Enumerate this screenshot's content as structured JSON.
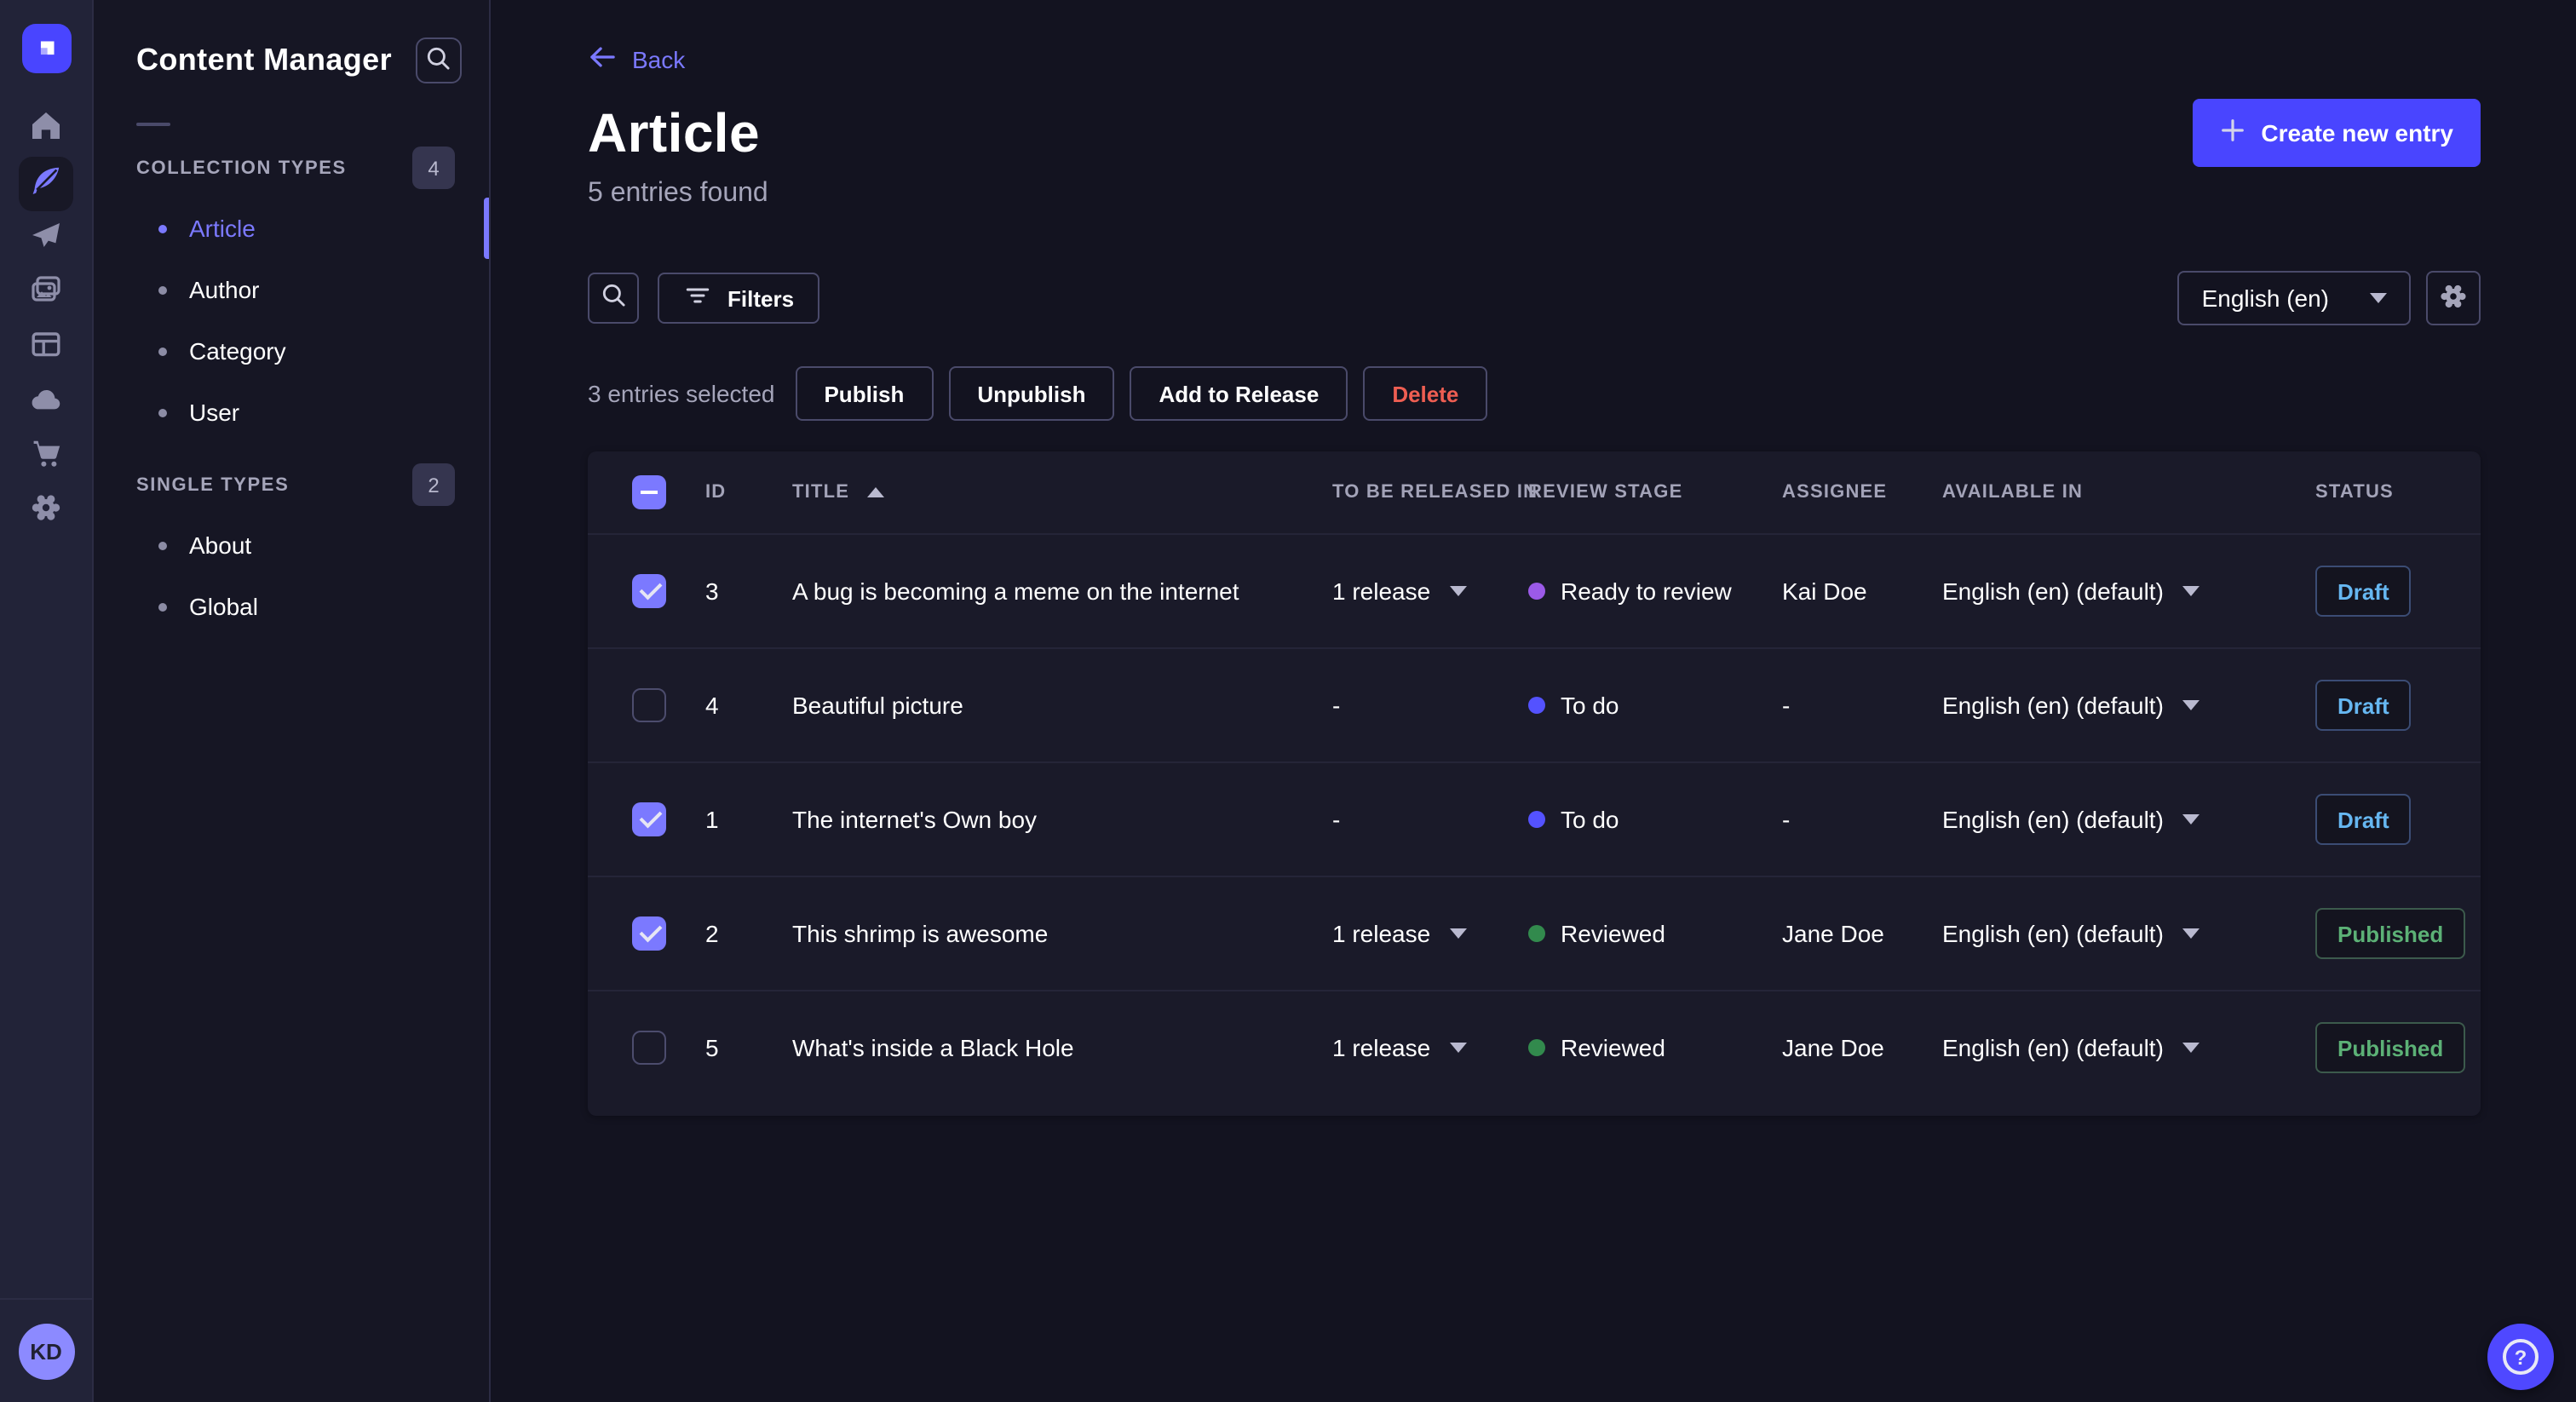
{
  "colors": {
    "primary": "#4945ff",
    "accent": "#7b79ff",
    "danger": "#ee5e52",
    "status_draft": "#66b7f1",
    "status_published": "#5cb176",
    "stage_ready_to_review": "#9b5ae8",
    "stage_to_do": "#5452ff",
    "stage_reviewed": "#328a4d"
  },
  "rail": {
    "items": [
      {
        "name": "home",
        "active": false
      },
      {
        "name": "content-manager",
        "active": true
      },
      {
        "name": "releases",
        "active": false
      },
      {
        "name": "media-library",
        "active": false
      },
      {
        "name": "content-type-builder",
        "active": false
      },
      {
        "name": "deploy-cloud",
        "active": false
      },
      {
        "name": "marketplace",
        "active": false
      },
      {
        "name": "settings",
        "active": false
      }
    ],
    "avatar_initials": "KD"
  },
  "sidebar": {
    "title": "Content Manager",
    "search_icon": "search-icon",
    "sections": [
      {
        "label": "COLLECTION TYPES",
        "badge": "4",
        "items": [
          {
            "label": "Article",
            "active": true
          },
          {
            "label": "Author",
            "active": false
          },
          {
            "label": "Category",
            "active": false
          },
          {
            "label": "User",
            "active": false
          }
        ]
      },
      {
        "label": "SINGLE TYPES",
        "badge": "2",
        "items": [
          {
            "label": "About",
            "active": false
          },
          {
            "label": "Global",
            "active": false
          }
        ]
      }
    ]
  },
  "header": {
    "back_label": "Back",
    "title": "Article",
    "subtitle": "5 entries found",
    "create_label": "Create new entry"
  },
  "toolbar": {
    "filters_label": "Filters",
    "locale_value": "English (en)"
  },
  "selection": {
    "summary": "3 entries selected",
    "publish_label": "Publish",
    "unpublish_label": "Unpublish",
    "add_to_release_label": "Add to Release",
    "delete_label": "Delete"
  },
  "table": {
    "sort": {
      "column": "TITLE",
      "direction": "asc"
    },
    "headers": {
      "id": "ID",
      "title": "TITLE",
      "released": "TO BE RELEASED IN",
      "stage": "REVIEW STAGE",
      "assignee": "ASSIGNEE",
      "available": "AVAILABLE IN",
      "status": "STATUS"
    },
    "rows": [
      {
        "checked": true,
        "id": "3",
        "title": "A bug is becoming a meme on the internet",
        "released": "1 release",
        "released_dropdown": true,
        "stage": "Ready to review",
        "stage_color": "#9b5ae8",
        "assignee": "Kai Doe",
        "available": "English (en) (default)",
        "status": "Draft",
        "status_type": "draft"
      },
      {
        "checked": false,
        "id": "4",
        "title": "Beautiful picture",
        "released": "-",
        "released_dropdown": false,
        "stage": "To do",
        "stage_color": "#5452ff",
        "assignee": "-",
        "available": "English (en) (default)",
        "status": "Draft",
        "status_type": "draft"
      },
      {
        "checked": true,
        "id": "1",
        "title": "The internet's Own boy",
        "released": "-",
        "released_dropdown": false,
        "stage": "To do",
        "stage_color": "#5452ff",
        "assignee": "-",
        "available": "English (en) (default)",
        "status": "Draft",
        "status_type": "draft"
      },
      {
        "checked": true,
        "id": "2",
        "title": "This shrimp is awesome",
        "released": "1 release",
        "released_dropdown": true,
        "stage": "Reviewed",
        "stage_color": "#328a4d",
        "assignee": "Jane Doe",
        "available": "English (en) (default)",
        "status": "Published",
        "status_type": "published"
      },
      {
        "checked": false,
        "id": "5",
        "title": "What's inside a Black Hole",
        "released": "1 release",
        "released_dropdown": true,
        "stage": "Reviewed",
        "stage_color": "#328a4d",
        "assignee": "Jane Doe",
        "available": "English (en) (default)",
        "status": "Published",
        "status_type": "published"
      }
    ]
  },
  "help": {
    "icon_label": "?"
  }
}
